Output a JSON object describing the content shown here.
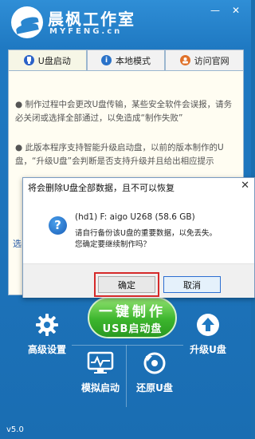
{
  "app": {
    "title": "晨枫工作室",
    "subtitle": "MYFENG.cn",
    "version": "v5.0",
    "colors": {
      "header": "#1f79c2",
      "accent_green": "#3cb52d"
    }
  },
  "window_controls": {
    "minimize": "—",
    "close": "✕"
  },
  "tabs": [
    {
      "label": "U盘启动",
      "icon": "usb-icon"
    },
    {
      "label": "本地模式",
      "icon": "info-icon"
    },
    {
      "label": "访问官网",
      "icon": "person-icon"
    }
  ],
  "info": {
    "p1": "● 制作过程中会更改U盘传输，某些安全软件会误报，请务必关闭或选择全部通过，以免造成“制作失败”",
    "p2": "● 此版本程序支持智能升级启动盘，以前的版本制作的U盘，“升级U盘”会判断是否支持升级并且给出相应提示",
    "side_label": "选"
  },
  "dialog": {
    "title": "将会删除U盘全部数据，且不可以恢复",
    "close": "✕",
    "device": "(hd1) F: aigo U268 (58.6 GB)",
    "line2": "请自行备份该U盘的重要数据，以免丢失。",
    "line3": "您确定要继续制作吗？",
    "confirm": "确定",
    "cancel": "取消"
  },
  "actions": {
    "make_line1": "一键制作",
    "make_line2": "USB启动盘",
    "advanced": "高级设置",
    "upgrade": "升级U盘",
    "simulate": "模拟启动",
    "restore": "还原U盘"
  }
}
